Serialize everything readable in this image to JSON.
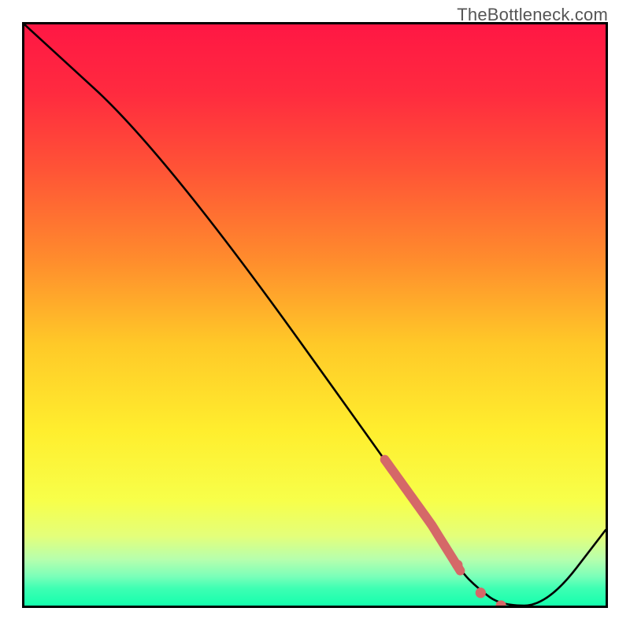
{
  "watermark": "TheBottleneck.com",
  "chart_data": {
    "type": "line",
    "title": "",
    "xlabel": "",
    "ylabel": "",
    "xlim": [
      0,
      100
    ],
    "ylim": [
      0,
      100
    ],
    "x": [
      0,
      24,
      70,
      75,
      78,
      82,
      90,
      100
    ],
    "values": [
      100,
      78,
      14,
      6,
      3,
      0,
      0,
      13
    ],
    "markers": {
      "color": "#d56868",
      "segment_from": 0.62,
      "segment_to": 0.75,
      "points_x": [
        74.5,
        78.5,
        82
      ],
      "points_y": [
        7,
        2.2,
        0
      ]
    },
    "gradient_stops": [
      {
        "offset": 0.0,
        "color": "#ff1744"
      },
      {
        "offset": 0.12,
        "color": "#ff2b3f"
      },
      {
        "offset": 0.25,
        "color": "#ff5436"
      },
      {
        "offset": 0.4,
        "color": "#ff8a2d"
      },
      {
        "offset": 0.55,
        "color": "#ffc928"
      },
      {
        "offset": 0.7,
        "color": "#ffee2e"
      },
      {
        "offset": 0.82,
        "color": "#f7ff4a"
      },
      {
        "offset": 0.88,
        "color": "#e4ff7a"
      },
      {
        "offset": 0.92,
        "color": "#b7ffad"
      },
      {
        "offset": 0.95,
        "color": "#7affb9"
      },
      {
        "offset": 0.97,
        "color": "#3effb3"
      },
      {
        "offset": 1.0,
        "color": "#15ffad"
      }
    ]
  }
}
